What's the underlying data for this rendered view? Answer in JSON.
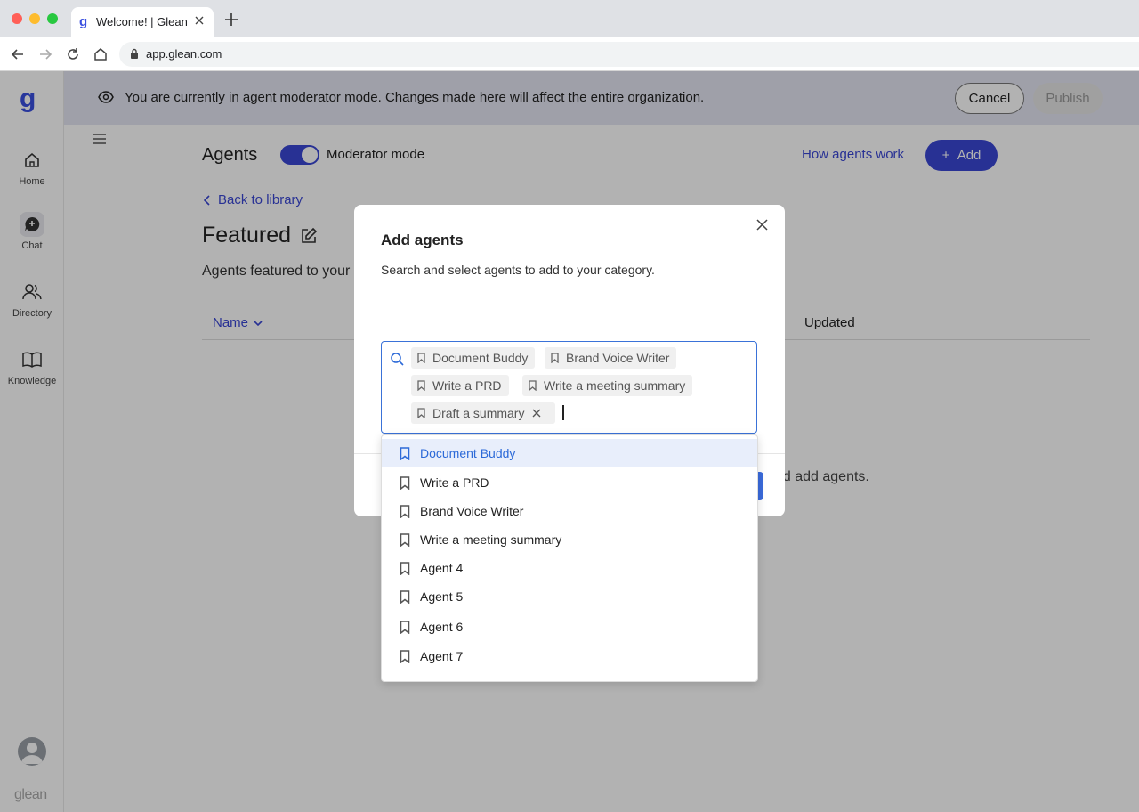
{
  "browser": {
    "tab_title": "Welcome! | Glean",
    "url": "app.glean.com",
    "favicon": "g"
  },
  "sidebar": {
    "logo": "g",
    "items": [
      {
        "label": "Home",
        "icon": "home-icon"
      },
      {
        "label": "Chat",
        "icon": "chat-icon"
      },
      {
        "label": "Directory",
        "icon": "people-icon"
      },
      {
        "label": "Knowledge",
        "icon": "book-icon"
      }
    ],
    "wordmark": "glean"
  },
  "banner": {
    "message": "You are currently in agent moderator mode. Changes made here will affect the entire organization.",
    "cancel_label": "Cancel",
    "publish_label": "Publish"
  },
  "header": {
    "title": "Agents",
    "toggle_label": "Moderator mode",
    "how_link": "How agents work",
    "add_label": "Add"
  },
  "page": {
    "back_label": "Back to library",
    "category_title": "Featured",
    "subtext": "Agents featured to your",
    "col_name": "Name",
    "col_updated": "Updated",
    "empty_text": "nd add agents."
  },
  "modal": {
    "title": "Add agents",
    "description": "Search and select agents to add to your category.",
    "chips": [
      "Document Buddy",
      "Brand Voice Writer",
      "Write a PRD",
      "Write a meeting summary",
      "Draft a summary"
    ]
  },
  "dropdown": {
    "items": [
      "Document Buddy",
      "Write a PRD",
      "Brand Voice Writer",
      "Write a meeting summary",
      "Agent 4",
      "Agent 5",
      "Agent 6",
      "Agent 7"
    ]
  },
  "colors": {
    "accent": "#3a47d5",
    "link_blue": "#2d6ad8",
    "banner_bg": "#e4e6f3"
  }
}
